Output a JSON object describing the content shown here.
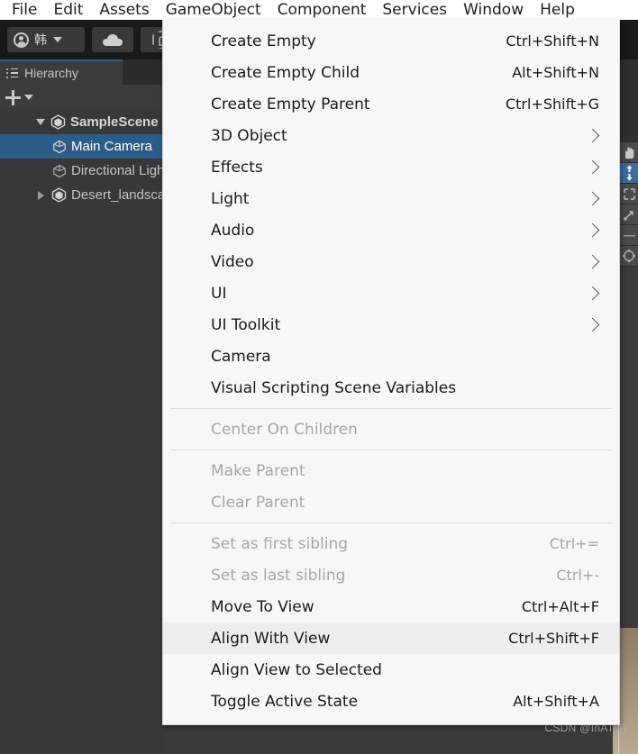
{
  "menubar": {
    "items": [
      {
        "label": "File",
        "active": false
      },
      {
        "label": "Edit",
        "active": false
      },
      {
        "label": "Assets",
        "active": false
      },
      {
        "label": "GameObject",
        "active": true
      },
      {
        "label": "Component",
        "active": false
      },
      {
        "label": "Services",
        "active": false
      },
      {
        "label": "Window",
        "active": false
      },
      {
        "label": "Help",
        "active": false
      }
    ]
  },
  "toolbar": {
    "account_icon": "account-icon",
    "account_language": "韩",
    "account_caret": "chevron-down-icon",
    "cloud_icon": "cloud-icon",
    "package_icon": "package-manager-icon"
  },
  "hierarchy": {
    "tab_label": "Hierarchy",
    "tab_icon": "hierarchy-icon",
    "add_button_icon": "plus-icon",
    "add_button_caret": "chevron-down-icon",
    "search_placeholder": "",
    "tree": [
      {
        "label": "SampleScene",
        "indent": 1,
        "icon": "unity-scene-icon",
        "expander": "down",
        "selected": false,
        "bold": true
      },
      {
        "label": "Main Camera",
        "indent": 2,
        "icon": "gameobject-cube-icon",
        "expander": "none",
        "selected": true,
        "bold": false
      },
      {
        "label": "Directional Light",
        "indent": 2,
        "icon": "gameobject-cube-icon",
        "expander": "none",
        "selected": false,
        "bold": false
      },
      {
        "label": "Desert_landscape",
        "indent": 1,
        "icon": "unity-scene-icon",
        "expander": "right",
        "selected": false,
        "bold": false
      }
    ]
  },
  "gameobject_menu": {
    "title": "GameObject",
    "groups": [
      {
        "items": [
          {
            "label": "Create Empty",
            "shortcut": "Ctrl+Shift+N",
            "submenu": false,
            "disabled": false,
            "highlighted": false
          },
          {
            "label": "Create Empty Child",
            "shortcut": "Alt+Shift+N",
            "submenu": false,
            "disabled": false,
            "highlighted": false
          },
          {
            "label": "Create Empty Parent",
            "shortcut": "Ctrl+Shift+G",
            "submenu": false,
            "disabled": false,
            "highlighted": false
          },
          {
            "label": "3D Object",
            "shortcut": "",
            "submenu": true,
            "disabled": false,
            "highlighted": false
          },
          {
            "label": "Effects",
            "shortcut": "",
            "submenu": true,
            "disabled": false,
            "highlighted": false
          },
          {
            "label": "Light",
            "shortcut": "",
            "submenu": true,
            "disabled": false,
            "highlighted": false
          },
          {
            "label": "Audio",
            "shortcut": "",
            "submenu": true,
            "disabled": false,
            "highlighted": false
          },
          {
            "label": "Video",
            "shortcut": "",
            "submenu": true,
            "disabled": false,
            "highlighted": false
          },
          {
            "label": "UI",
            "shortcut": "",
            "submenu": true,
            "disabled": false,
            "highlighted": false
          },
          {
            "label": "UI Toolkit",
            "shortcut": "",
            "submenu": true,
            "disabled": false,
            "highlighted": false
          },
          {
            "label": "Camera",
            "shortcut": "",
            "submenu": false,
            "disabled": false,
            "highlighted": false
          },
          {
            "label": "Visual Scripting Scene Variables",
            "shortcut": "",
            "submenu": false,
            "disabled": false,
            "highlighted": false
          }
        ]
      },
      {
        "items": [
          {
            "label": "Center On Children",
            "shortcut": "",
            "submenu": false,
            "disabled": true,
            "highlighted": false
          }
        ]
      },
      {
        "items": [
          {
            "label": "Make Parent",
            "shortcut": "",
            "submenu": false,
            "disabled": true,
            "highlighted": false
          },
          {
            "label": "Clear Parent",
            "shortcut": "",
            "submenu": false,
            "disabled": true,
            "highlighted": false
          }
        ]
      },
      {
        "items": [
          {
            "label": "Set as first sibling",
            "shortcut": "Ctrl+=",
            "submenu": false,
            "disabled": true,
            "highlighted": false
          },
          {
            "label": "Set as last sibling",
            "shortcut": "Ctrl+-",
            "submenu": false,
            "disabled": true,
            "highlighted": false
          },
          {
            "label": "Move To View",
            "shortcut": "Ctrl+Alt+F",
            "submenu": false,
            "disabled": false,
            "highlighted": false
          },
          {
            "label": "Align With View",
            "shortcut": "Ctrl+Shift+F",
            "submenu": false,
            "disabled": false,
            "highlighted": true
          },
          {
            "label": "Align View to Selected",
            "shortcut": "",
            "submenu": false,
            "disabled": false,
            "highlighted": false
          },
          {
            "label": "Toggle Active State",
            "shortcut": "Alt+Shift+A",
            "submenu": false,
            "disabled": false,
            "highlighted": false
          }
        ]
      }
    ]
  },
  "scene_tools": [
    {
      "icon": "hand-tool-icon",
      "active": false
    },
    {
      "icon": "move-tool-icon",
      "active": true
    },
    {
      "icon": "rect-tool-icon",
      "active": false
    },
    {
      "icon": "scale-tool-icon",
      "active": false
    },
    {
      "icon": "divider-icon",
      "active": false
    },
    {
      "icon": "transform-tool-icon",
      "active": false
    }
  ],
  "watermark": {
    "text": "CSDN @InATeR"
  },
  "colors": {
    "menu_background": "#f7f7f7",
    "menu_highlight": "#ededed",
    "menubar_background": "#ffffff",
    "editor_background": "#383838",
    "toolbar_background": "#191919",
    "selection_blue": "#2c5d87",
    "disabled_text": "#a6a6a6"
  }
}
